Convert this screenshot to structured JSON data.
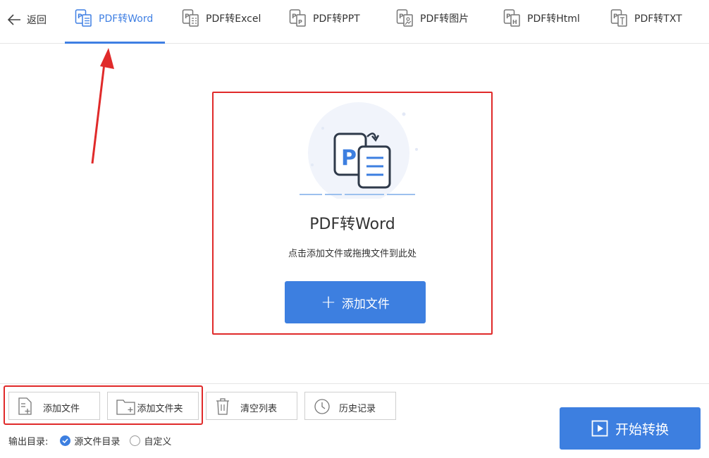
{
  "nav": {
    "back_label": "返回",
    "tabs": [
      {
        "label": "PDF转Word",
        "icon": "pdf-word-icon",
        "active": true
      },
      {
        "label": "PDF转Excel",
        "icon": "pdf-excel-icon",
        "active": false
      },
      {
        "label": "PDF转PPT",
        "icon": "pdf-ppt-icon",
        "active": false
      },
      {
        "label": "PDF转图片",
        "icon": "pdf-image-icon",
        "active": false
      },
      {
        "label": "PDF转Html",
        "icon": "pdf-html-icon",
        "active": false
      },
      {
        "label": "PDF转TXT",
        "icon": "pdf-txt-icon",
        "active": false
      }
    ]
  },
  "drop": {
    "title": "PDF转Word",
    "subtitle": "点击添加文件或拖拽文件到此处",
    "add_button": "添加文件"
  },
  "toolbar": {
    "add_file": "添加文件",
    "add_folder": "添加文件夹",
    "clear_list": "清空列表",
    "history": "历史记录"
  },
  "output": {
    "label": "输出目录:",
    "options": [
      {
        "label": "源文件目录",
        "selected": true
      },
      {
        "label": "自定义",
        "selected": false
      }
    ]
  },
  "start_button": "开始转换",
  "colors": {
    "accent": "#3d7fe0",
    "annotation": "#e02a2a"
  }
}
